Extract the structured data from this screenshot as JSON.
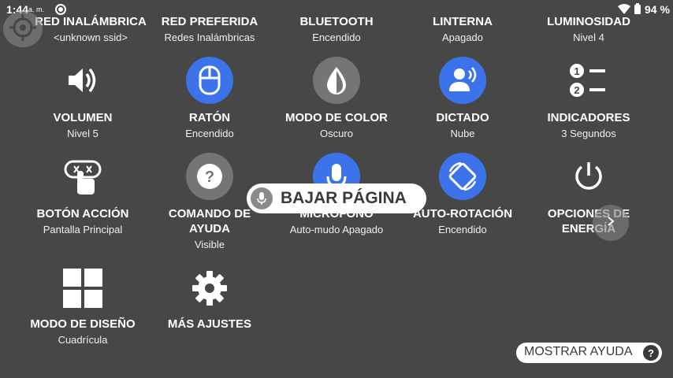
{
  "status_bar": {
    "time": "1:44",
    "ampm": "a. m.",
    "battery_pct": "94 %",
    "icons": [
      "camera-icon",
      "wifi-icon",
      "battery-icon"
    ]
  },
  "tiles": {
    "red_inalambrica": {
      "label": "RED INALÁMBRICA",
      "value": "<unknown ssid>"
    },
    "red_preferida": {
      "label": "RED PREFERIDA",
      "value": "Redes Inalámbricas"
    },
    "bluetooth": {
      "label": "BLUETOOTH",
      "value": "Encendido"
    },
    "linterna": {
      "label": "LINTERNA",
      "value": "Apagado"
    },
    "luminosidad": {
      "label": "LUMINOSIDAD",
      "value": "Nivel 4"
    },
    "volumen": {
      "label": "VOLUMEN",
      "value": "Nivel 5",
      "icon": "volume-icon"
    },
    "raton": {
      "label": "RATÓN",
      "value": "Encendido",
      "icon": "mouse-icon"
    },
    "modo_color": {
      "label": "MODO DE COLOR",
      "value": "Oscuro",
      "icon": "color-mode-icon"
    },
    "dictado": {
      "label": "DICTADO",
      "value": "Nube",
      "icon": "dictation-icon"
    },
    "indicadores": {
      "label": "INDICADORES",
      "value": "3 Segundos",
      "icon": "indicators-icon"
    },
    "boton_accion": {
      "label": "BOTÓN ACCIÓN",
      "value": "Pantalla Principal",
      "icon": "action-button-icon"
    },
    "comando_ayuda": {
      "label": "COMANDO DE",
      "label2": "AYUDA",
      "value": "Visible",
      "icon": "help-command-icon"
    },
    "microfono": {
      "label": "MICRÓFONO",
      "value": "Auto-mudo Apagado",
      "icon": "microphone-icon"
    },
    "auto_rotacion": {
      "label": "AUTO-ROTACIÓN",
      "value": "Encendido",
      "icon": "rotation-icon"
    },
    "opciones_energia": {
      "label": "OPCIONES DE",
      "label2": "ENERGÍA",
      "icon": "power-icon"
    },
    "modo_diseno": {
      "label": "MODO DE DISEÑO",
      "value": "Cuadrícula",
      "icon": "grid-icon"
    },
    "mas_ajustes": {
      "label": "MÁS AJUSTES",
      "icon": "gear-icon"
    }
  },
  "toast": {
    "text": "BAJAR PÁGINA"
  },
  "help_button": {
    "label": "MOSTRAR AYUDA",
    "q": "?"
  },
  "colors": {
    "background": "#474747",
    "accent_blue": "#3c73ea",
    "gray_circle": "#757575"
  }
}
